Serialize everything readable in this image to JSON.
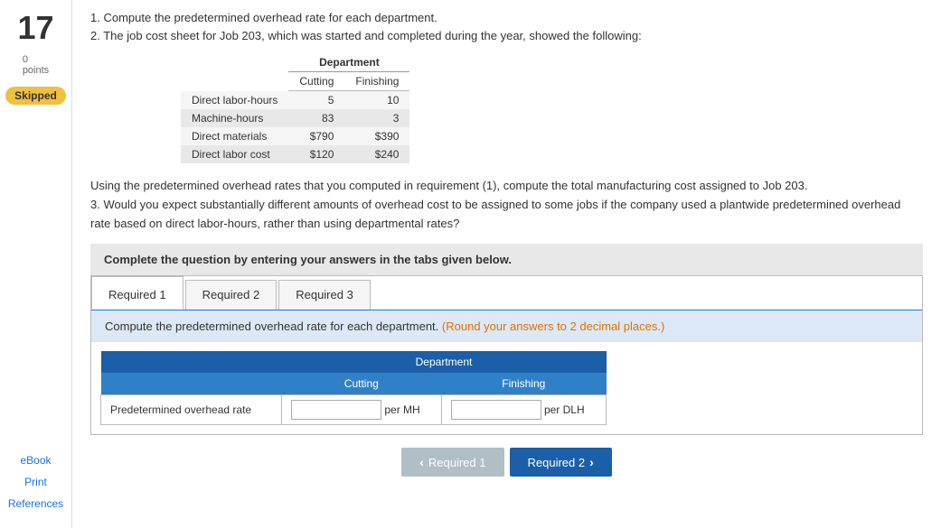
{
  "sidebar": {
    "number": "17",
    "points_label": "points",
    "points_value": "0",
    "skipped_label": "Skipped",
    "links": [
      {
        "label": "eBook",
        "name": "ebook-link"
      },
      {
        "label": "Print",
        "name": "print-link"
      },
      {
        "label": "References",
        "name": "references-link"
      }
    ]
  },
  "problem": {
    "line1": "1. Compute the predetermined overhead rate for each department.",
    "line2": "2. The job cost sheet for Job 203, which was started and completed during the year, showed the following:",
    "dept_table": {
      "header": "Department",
      "cols": [
        "Cutting",
        "Finishing"
      ],
      "rows": [
        {
          "label": "Direct labor-hours",
          "cutting": "5",
          "finishing": "10"
        },
        {
          "label": "Machine-hours",
          "cutting": "83",
          "finishing": "3"
        },
        {
          "label": "Direct materials",
          "cutting": "$790",
          "finishing": "$390"
        },
        {
          "label": "Direct labor cost",
          "cutting": "$120",
          "finishing": "$240"
        }
      ]
    },
    "para2": "Using the predetermined overhead rates that you computed in requirement (1), compute the total manufacturing cost assigned to Job 203.",
    "para3": "3. Would you expect substantially different amounts of overhead cost to be assigned to some jobs if the company used a plantwide predetermined overhead rate based on direct labor-hours, rather than using departmental rates?"
  },
  "complete_bar": {
    "text": "Complete the question by entering your answers in the tabs given below."
  },
  "tabs": [
    {
      "label": "Required 1",
      "name": "required-1-tab"
    },
    {
      "label": "Required 2",
      "name": "required-2-tab"
    },
    {
      "label": "Required 3",
      "name": "required-3-tab"
    }
  ],
  "active_tab": "Required 1",
  "instruction": {
    "main": "Compute the predetermined overhead rate for each department.",
    "note": "(Round your answers to 2 decimal places.)"
  },
  "req_table": {
    "dept_header": "Department",
    "col_cutting": "Cutting",
    "col_finishing": "Finishing",
    "row_label": "Predetermined overhead rate",
    "unit_cutting": "per MH",
    "unit_finishing": "per DLH"
  },
  "nav": {
    "prev_label": "Required 1",
    "next_label": "Required 2"
  }
}
